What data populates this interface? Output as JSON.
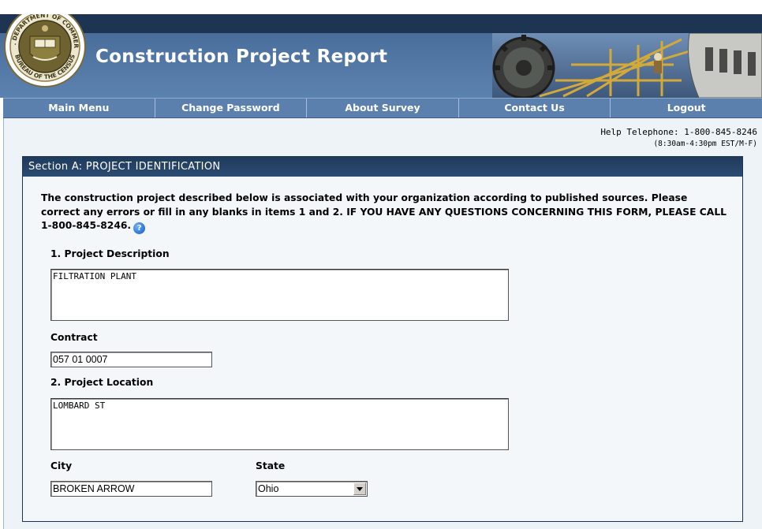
{
  "header": {
    "title": "Construction Project Report",
    "seal_text_top": "U.S. DEPARTMENT OF COMMERCE",
    "seal_text_bottom": "BUREAU OF THE CENSUS"
  },
  "nav": {
    "items": [
      {
        "label": "Main Menu"
      },
      {
        "label": "Change Password"
      },
      {
        "label": "About Survey"
      },
      {
        "label": "Contact Us"
      },
      {
        "label": "Logout"
      }
    ]
  },
  "help": {
    "phone": "Help Telephone: 1-800-845-8246",
    "hours": "(8:30am-4:30pm EST/M-F)"
  },
  "section": {
    "title": "Section A: PROJECT IDENTIFICATION",
    "intro": "The construction project described below is associated with your organization according to published sources. Please correct any errors or fill in any blanks in items 1 and 2. IF YOU HAVE ANY QUESTIONS CONCERNING THIS FORM, PLEASE CALL 1-800-845-8246.",
    "help_icon": "question-mark-icon"
  },
  "form": {
    "project_description_label": "1. Project Description",
    "project_description_value": "FILTRATION PLANT",
    "contract_label": "Contract",
    "contract_value": "057 01 0007",
    "project_location_label": "2. Project Location",
    "project_location_value": "LOMBARD ST",
    "city_label": "City",
    "city_value": "BROKEN ARROW",
    "state_label": "State",
    "state_value": "Ohio"
  }
}
